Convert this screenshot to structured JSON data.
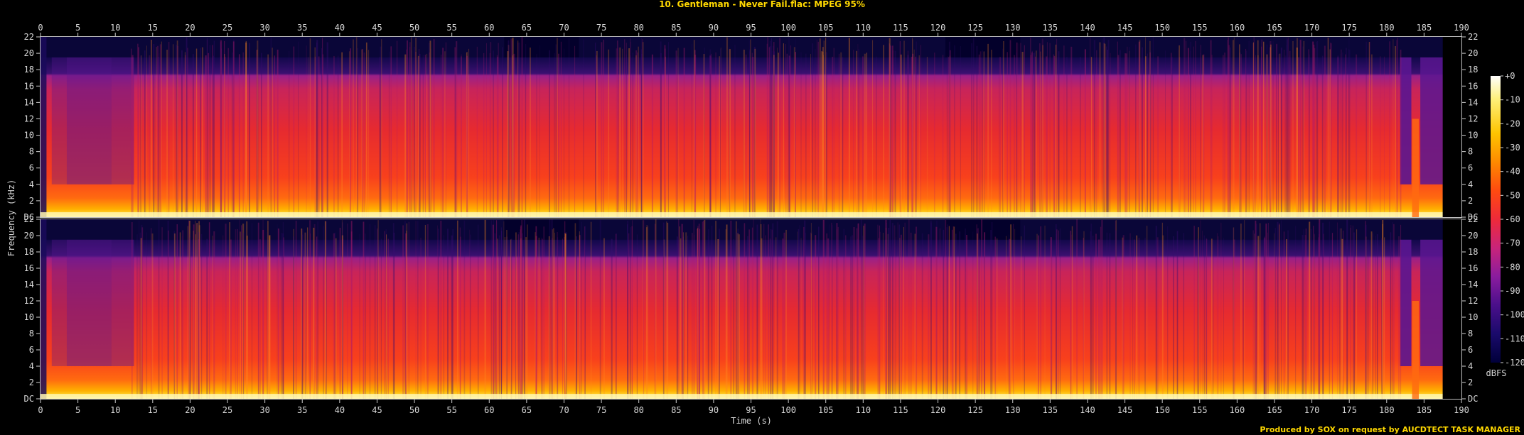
{
  "chart_data": {
    "type": "heatmap",
    "title": "10. Gentleman - Never Fail.flac: MPEG 95%",
    "xlabel": "Time (s)",
    "ylabel": "Frequency (kHz)",
    "xlim": [
      0,
      190
    ],
    "ylim": [
      0,
      22
    ],
    "x_ticks": [
      0,
      5,
      10,
      15,
      20,
      25,
      30,
      35,
      40,
      45,
      50,
      55,
      60,
      65,
      70,
      75,
      80,
      85,
      90,
      95,
      100,
      105,
      110,
      115,
      120,
      125,
      130,
      135,
      140,
      145,
      150,
      155,
      160,
      165,
      170,
      175,
      180,
      185,
      190
    ],
    "y_ticks": [
      2,
      4,
      6,
      8,
      10,
      12,
      14,
      16,
      18,
      20
    ],
    "y_top_label": "22",
    "y_bottom_label": "DC",
    "channels": [
      {
        "name": "",
        "lowpass_cutoff_khz": 19.5
      },
      {
        "name": "",
        "lowpass_cutoff_khz": 19.5
      }
    ],
    "colorbar": {
      "unit": "dBFS",
      "ticks": [
        "+0",
        "-10",
        "-20",
        "-30",
        "-40",
        "-50",
        "-60",
        "-70",
        "-80",
        "-90",
        "-100",
        "-110",
        "-120"
      ],
      "range": [
        -120,
        0
      ]
    },
    "footer": "Produced by SOX on request by AUCDTECT TASK MANAGER",
    "colors": {
      "background": "#000000",
      "title": "#ffd800",
      "palette": [
        "#00003a",
        "#1a0a6b",
        "#4a0f8a",
        "#8a1c9e",
        "#c8247a",
        "#ee2a3a",
        "#ff4a10",
        "#ff8a00",
        "#ffc400",
        "#fff07a",
        "#ffffff"
      ]
    }
  }
}
